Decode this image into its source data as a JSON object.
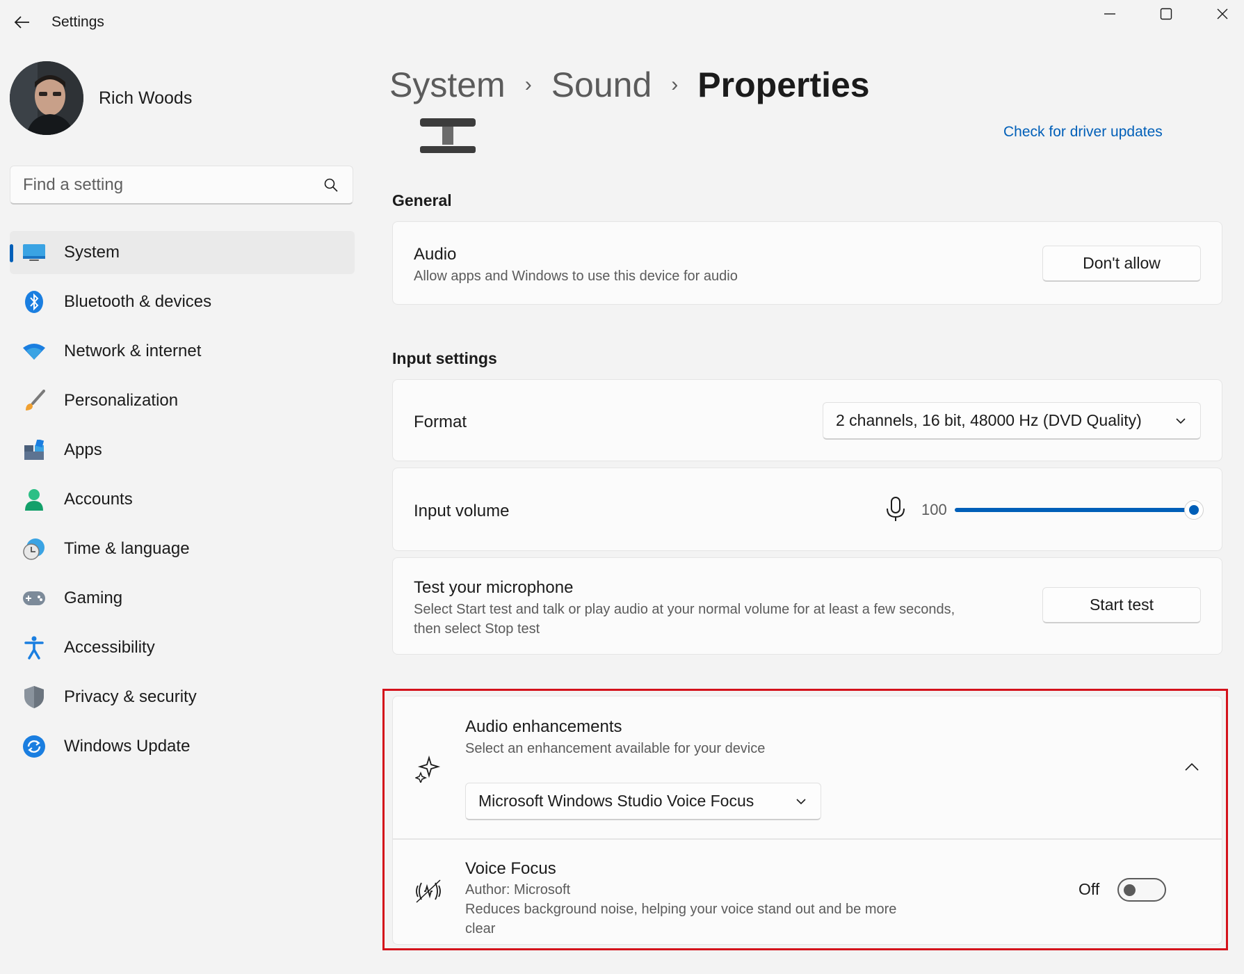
{
  "window": {
    "title": "Settings",
    "controls": {
      "minimize": "minimize-icon",
      "maximize": "maximize-icon",
      "close": "close-icon"
    }
  },
  "user": {
    "name": "Rich Woods"
  },
  "search": {
    "placeholder": "Find a setting"
  },
  "sidebar": {
    "items": [
      {
        "label": "System",
        "icon": "system-icon",
        "active": true
      },
      {
        "label": "Bluetooth & devices",
        "icon": "bluetooth-icon"
      },
      {
        "label": "Network & internet",
        "icon": "wifi-icon"
      },
      {
        "label": "Personalization",
        "icon": "brush-icon"
      },
      {
        "label": "Apps",
        "icon": "apps-icon"
      },
      {
        "label": "Accounts",
        "icon": "accounts-icon"
      },
      {
        "label": "Time & language",
        "icon": "clock-globe-icon"
      },
      {
        "label": "Gaming",
        "icon": "gamepad-icon"
      },
      {
        "label": "Accessibility",
        "icon": "accessibility-icon"
      },
      {
        "label": "Privacy & security",
        "icon": "shield-icon"
      },
      {
        "label": "Windows Update",
        "icon": "update-icon"
      }
    ]
  },
  "breadcrumb": {
    "items": [
      "System",
      "Sound",
      "Properties"
    ]
  },
  "header": {
    "driver_link": "Check for driver updates"
  },
  "general": {
    "title": "General",
    "audio": {
      "title": "Audio",
      "description": "Allow apps and Windows to use this device for audio",
      "button": "Don't allow"
    }
  },
  "input_settings": {
    "title": "Input settings",
    "format": {
      "label": "Format",
      "value": "2 channels, 16 bit, 48000 Hz (DVD Quality)"
    },
    "volume": {
      "label": "Input volume",
      "value": "100",
      "level": 1.0
    },
    "test": {
      "title": "Test your microphone",
      "description_line1": "Select Start test and talk or play audio at your normal volume for at least a few seconds,",
      "description_line2": "then select Stop test",
      "button": "Start test"
    }
  },
  "enhancements": {
    "title": "Audio enhancements",
    "description": "Select an enhancement available for your device",
    "value": "Microsoft Windows Studio Voice Focus",
    "voice_focus": {
      "title": "Voice Focus",
      "author": "Author: Microsoft",
      "description_line1": "Reduces background noise, helping your voice stand out and be more",
      "description_line2": "clear",
      "state": "Off"
    }
  },
  "colors": {
    "accent": "#005fb8",
    "highlight": "#d4121b"
  }
}
